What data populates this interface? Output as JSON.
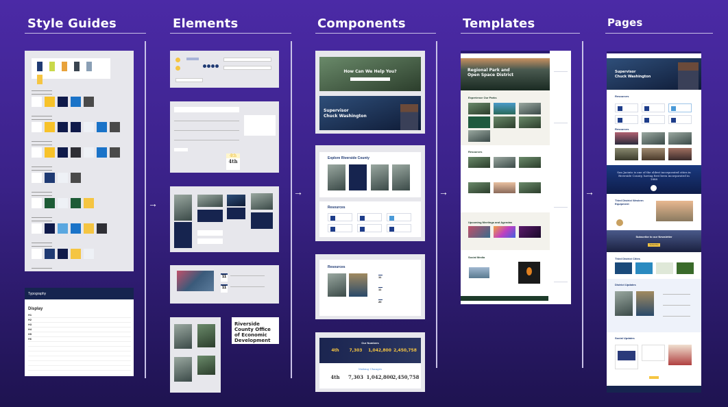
{
  "columns": [
    {
      "title": "Style Guides"
    },
    {
      "title": "Elements"
    },
    {
      "title": "Components"
    },
    {
      "title": "Templates"
    },
    {
      "title": "Pages"
    }
  ],
  "style_guides": {
    "palette_colors": [
      "#1f3a73",
      "#c9d94a",
      "#e8a23a",
      "#3a4450",
      "#8a9fb5",
      "#f5c542"
    ],
    "theme_rows": [
      [
        "#ffffff",
        "#f7c22a",
        "#0f1a4a",
        "#1a73c8",
        "#4a4a4a"
      ],
      [
        "#ffffff",
        "#f7c22a",
        "#0f1a4a",
        "#0f1a4a",
        "#eef1f6",
        "#1a73c8",
        "#4a4a4a"
      ],
      [
        "#ffffff",
        "#f7c22a",
        "#0f1a4a",
        "#2f2f35",
        "#eef1f6",
        "#1a73c8",
        "#4a4a4a"
      ],
      [
        "#ffffff",
        "#1f3a73",
        "#eef1f6",
        "#4a4a4a"
      ],
      [
        "#ffffff",
        "#1d5b36",
        "#eef1f6",
        "#1d5b36",
        "#f5c542"
      ],
      [
        "#ffffff",
        "#0f1a4a",
        "#5aa7e0",
        "#1a73c8",
        "#f5c542",
        "#2f2f35"
      ],
      [
        "#ffffff",
        "#1f3a73",
        "#0f1a4a",
        "#f5c542",
        "#eef1f6"
      ],
      [
        "#ffffff",
        "#c41e4a",
        "#0f1a4a",
        "#eef1f6",
        "#1a73c8",
        "#4a4a4a"
      ]
    ],
    "typography": {
      "title": "Typography",
      "display_label": "Display",
      "rows": [
        "H1",
        "H2",
        "H3",
        "H4",
        "H5",
        "H6"
      ]
    }
  },
  "elements": {
    "stat_yellow": "4th",
    "stat_dark": "4th",
    "event_day": "11",
    "card_title": "Riverside County Office of Economic Development"
  },
  "components": {
    "search_hero": {
      "heading": "How Can We Help You?"
    },
    "supervisor_hero": {
      "line1": "Supervisor",
      "line2": "Chuck Washington"
    },
    "explore": {
      "heading": "Explore Riverside County"
    },
    "resources": {
      "heading": "Resources"
    },
    "news": {
      "heading": "Resources",
      "event_days": [
        "11",
        "11",
        "20"
      ]
    },
    "numbers": {
      "heading": "Our Numbers",
      "stats": [
        "4th",
        "7,303",
        "1,042,800",
        "2,450,758"
      ],
      "heading2": "Making Changes"
    }
  },
  "templates": {
    "hero_title": "Regional Park and Open Space District",
    "parks_heading": "Experience Our Parks",
    "resources_heading": "Resources",
    "meetings_heading": "Upcoming Meetings and Agendas",
    "social_heading": "Social Media"
  },
  "pages": {
    "hero_line1": "Supervisor",
    "hero_line2": "Chuck Washington",
    "resources_heading": "Resources",
    "news_heading": "Resources",
    "quote": "San Jacinto is one of the oldest incorporated cities in Riverside County, having first been incorporated in 1888",
    "district_heading": "Third District Western Equipment",
    "newsletter": "Subscribe to our Newsletter",
    "newsletter_button": "Subscribe",
    "cities_heading": "Third District Cities",
    "updates_heading": "District Updates",
    "social_heading": "Social Updates"
  }
}
